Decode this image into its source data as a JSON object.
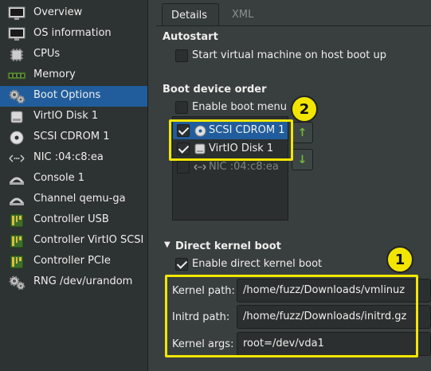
{
  "sidebar": {
    "items": [
      {
        "label": "Overview",
        "icon": "monitor-icon"
      },
      {
        "label": "OS information",
        "icon": "monitor-icon"
      },
      {
        "label": "CPUs",
        "icon": "cpu-chip-icon"
      },
      {
        "label": "Memory",
        "icon": "memory-icon"
      },
      {
        "label": "Boot Options",
        "icon": "gears-icon"
      },
      {
        "label": "VirtIO Disk 1",
        "icon": "disk-icon"
      },
      {
        "label": "SCSI CDROM 1",
        "icon": "cdrom-icon"
      },
      {
        "label": "NIC :04:c8:ea",
        "icon": "network-icon"
      },
      {
        "label": "Console 1",
        "icon": "console-icon"
      },
      {
        "label": "Channel qemu-ga",
        "icon": "channel-icon"
      },
      {
        "label": "Controller USB",
        "icon": "controller-icon"
      },
      {
        "label": "Controller VirtIO SCSI",
        "icon": "controller-icon"
      },
      {
        "label": "Controller PCIe",
        "icon": "controller-icon"
      },
      {
        "label": "RNG /dev/urandom",
        "icon": "gears-icon"
      }
    ],
    "selected": "Boot Options"
  },
  "tabs": {
    "details": "Details",
    "xml": "XML"
  },
  "autostart": {
    "title": "Autostart",
    "checkbox_label": "Start virtual machine on host boot up",
    "checked": false
  },
  "boot_order": {
    "title": "Boot device order",
    "menu_label": "Enable boot menu",
    "menu_checked": false,
    "devices": [
      {
        "label": "SCSI CDROM 1",
        "checked": true,
        "icon": "cdrom-icon"
      },
      {
        "label": "VirtIO Disk 1",
        "checked": true,
        "icon": "disk-icon"
      },
      {
        "label": "NIC :04:c8:ea",
        "checked": false,
        "icon": "network-icon"
      }
    ],
    "up_label": "↑",
    "down_label": "↓"
  },
  "kernel": {
    "title": "Direct kernel boot",
    "enable_label": "Enable direct kernel boot",
    "enabled": true,
    "kernel_path_label": "Kernel path:",
    "kernel_path": "/home/fuzz/Downloads/vmlinuz",
    "initrd_path_label": "Initrd path:",
    "initrd_path": "/home/fuzz/Downloads/initrd.gz",
    "kernel_args_label": "Kernel args:",
    "kernel_args": "root=/dev/vda1"
  },
  "annotations": {
    "badge1": "1",
    "badge2": "2"
  },
  "colors": {
    "accent": "#215d9c",
    "highlight": "#f2e600",
    "arrow": "#6fb93a"
  }
}
